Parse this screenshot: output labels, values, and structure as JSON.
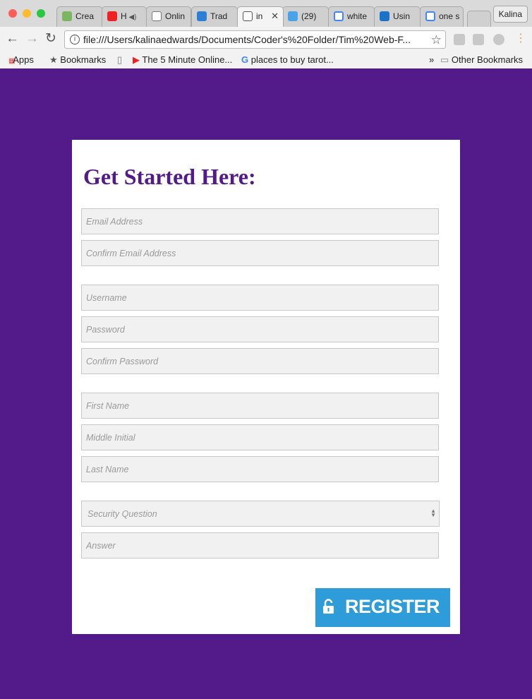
{
  "browser": {
    "tabs": [
      {
        "label": "Crea"
      },
      {
        "label": "H"
      },
      {
        "label": "Onlin"
      },
      {
        "label": "Trad"
      },
      {
        "label": "in"
      },
      {
        "label": "(29)"
      },
      {
        "label": "white"
      },
      {
        "label": "Usin"
      },
      {
        "label": "one s"
      }
    ],
    "profile": "Kalina",
    "url": "file:///Users/kalinaedwards/Documents/Coder's%20Folder/Tim%20Web-F...",
    "bookmarks": {
      "apps": "Apps",
      "bookmarks": "Bookmarks",
      "five_min": "The 5 Minute Online...",
      "tarot": "places to buy tarot...",
      "more": "»",
      "other": "Other Bookmarks"
    }
  },
  "form": {
    "title": "Get Started Here:",
    "email_placeholder": "Email Address",
    "confirm_email_placeholder": "Confirm Email Address",
    "username_placeholder": "Username",
    "password_placeholder": "Password",
    "confirm_password_placeholder": "Confirm Password",
    "first_name_placeholder": "First Name",
    "middle_initial_placeholder": "Middle Initial",
    "last_name_placeholder": "Last Name",
    "security_question_value": "Security Question",
    "answer_placeholder": "Answer",
    "register_label": "REGISTER"
  },
  "colors": {
    "background": "#531b8a",
    "title": "#531b8a",
    "register_button": "#2d9cd8",
    "field_bg": "#f1f1f1"
  }
}
